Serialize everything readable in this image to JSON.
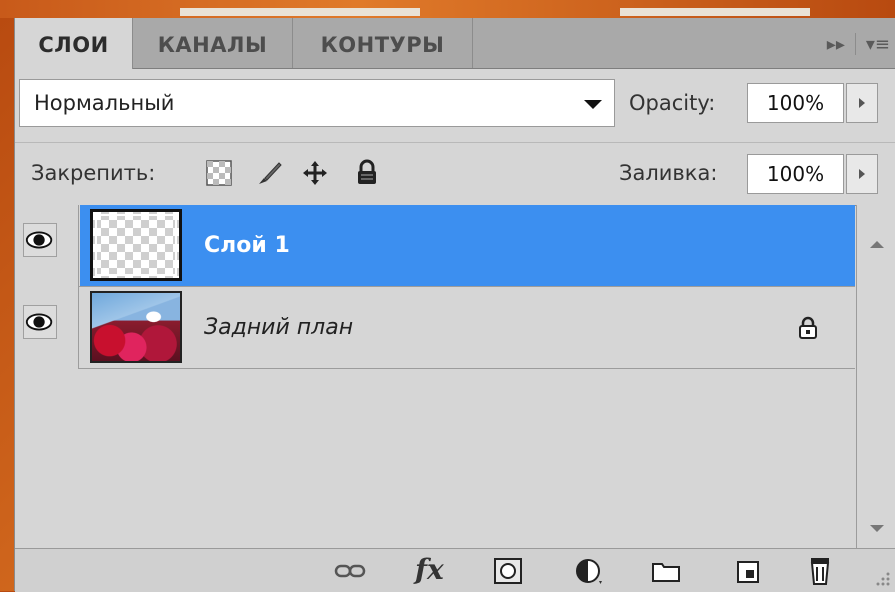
{
  "tabs": [
    {
      "label": "СЛОИ"
    },
    {
      "label": "КАНАЛЫ"
    },
    {
      "label": "КОНТУРЫ"
    }
  ],
  "tab_tools": {
    "expand": "▸▸",
    "menu": "▾≡"
  },
  "blend": {
    "mode": "Нормальный",
    "opacity_label": "Opacity:",
    "opacity_value": "100%"
  },
  "lock": {
    "label": "Закрепить:",
    "fill_label": "Заливка:",
    "fill_value": "100%"
  },
  "layers": [
    {
      "name": "Слой 1",
      "selected": true,
      "visible": true
    },
    {
      "name": "Задний план",
      "selected": false,
      "visible": true,
      "locked": true
    }
  ],
  "colors": {
    "selection": "#3c8ff0",
    "panel": "#d6d6d6",
    "tabs_bg": "#a9a9a9",
    "desktop": "#c85a1a"
  },
  "bottom_toolbar": {
    "fx_label": "fx",
    "icons": [
      "link-layers-icon",
      "fx-icon",
      "add-mask-icon",
      "adjustment-layer-icon",
      "new-group-icon",
      "new-layer-icon",
      "trash-icon"
    ]
  }
}
